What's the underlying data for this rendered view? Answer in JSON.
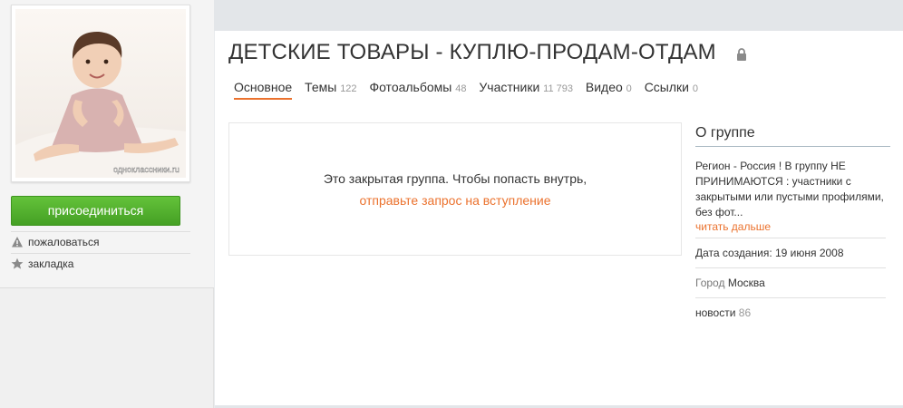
{
  "group": {
    "title": "ДЕТСКИЕ ТОВАРЫ - КУПЛЮ-ПРОДАМ-ОТДАМ",
    "avatar_watermark": "одноклассники.ru"
  },
  "sidebar": {
    "join_label": "присоединиться",
    "complain_label": "пожаловаться",
    "bookmark_label": "закладка"
  },
  "tabs": [
    {
      "label": "Основное",
      "count": ""
    },
    {
      "label": "Темы",
      "count": "122"
    },
    {
      "label": "Фотоальбомы",
      "count": "48"
    },
    {
      "label": "Участники",
      "count": "11 793"
    },
    {
      "label": "Видео",
      "count": "0"
    },
    {
      "label": "Ссылки",
      "count": "0"
    }
  ],
  "closed": {
    "message": "Это закрытая группа. Чтобы попасть внутрь,",
    "request_link": "отправьте запрос на вступление"
  },
  "about": {
    "heading": "О группе",
    "description": "Регион - Россия !  В группу  НЕ ПРИНИМАЮТСЯ  :  участники с закрытыми или пустыми профилями, без фот...",
    "read_more": "читать дальше",
    "created": "Дата создания: 19 июня 2008",
    "city_label": "Город",
    "city_value": "Москва",
    "news_label": "новости",
    "news_count": "86"
  },
  "colors": {
    "accent_orange": "#eb722e",
    "join_green": "#53b12e"
  }
}
